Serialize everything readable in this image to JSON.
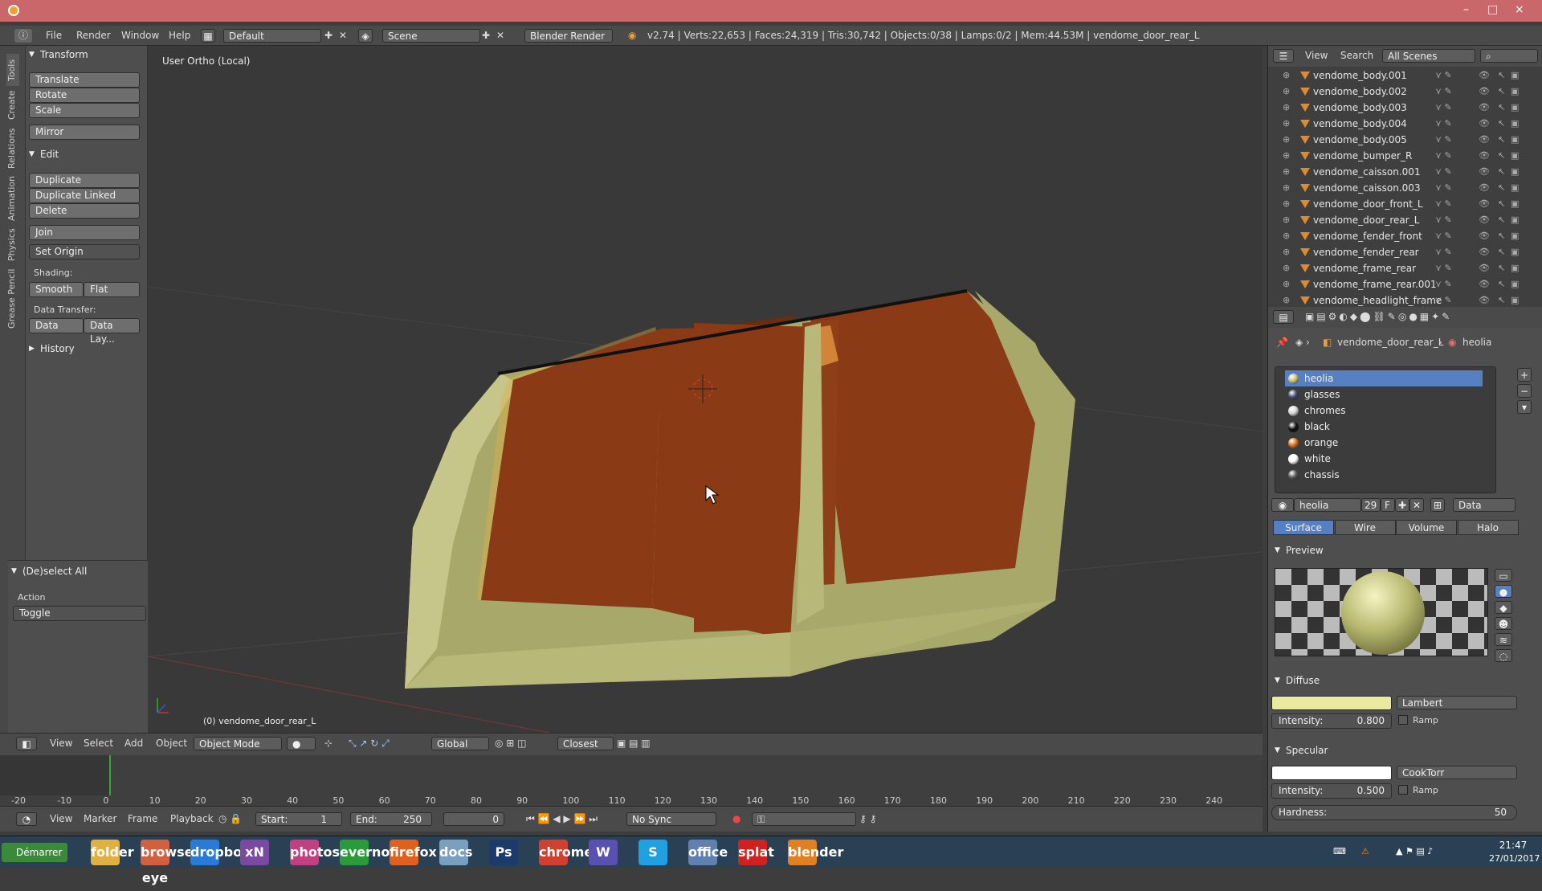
{
  "title_bar": {
    "controls": [
      "–",
      "□",
      "×"
    ]
  },
  "info_header": {
    "menus": [
      "File",
      "Render",
      "Window",
      "Help"
    ],
    "layout": "Default",
    "scene": "Scene",
    "render_engine": "Blender Render",
    "stats": "v2.74 | Verts:22,653 | Faces:24,319 | Tris:30,742 | Objects:0/38 | Lamps:0/2 | Mem:44.53M | vendome_door_rear_L"
  },
  "left_tabs": [
    "Tools",
    "Create",
    "Relations",
    "Animation",
    "Physics",
    "Grease Pencil"
  ],
  "tool_shelf": {
    "transform_header": "Transform",
    "transform_buttons": [
      "Translate",
      "Rotate",
      "Scale"
    ],
    "mirror": "Mirror",
    "edit_header": "Edit",
    "edit_buttons": [
      "Duplicate",
      "Duplicate Linked",
      "Delete"
    ],
    "join": "Join",
    "set_origin": "Set Origin",
    "shading_label": "Shading:",
    "smooth": "Smooth",
    "flat": "Flat",
    "data_transfer_label": "Data Transfer:",
    "data": "Data",
    "data_layers": "Data Lay...",
    "history_header": "History",
    "operator_header": "(De)select All",
    "action_label": "Action",
    "action_value": "Toggle"
  },
  "viewport": {
    "view_label": "User Ortho (Local)",
    "object_label": "(0) vendome_door_rear_L",
    "body_color": "#b8b878",
    "panel_color": "#8a3a14"
  },
  "viewport_header": {
    "menus": [
      "View",
      "Select",
      "Add",
      "Object"
    ],
    "mode": "Object Mode",
    "orientation": "Global",
    "snap": "Closest"
  },
  "timeline": {
    "ticks": [
      "-20",
      "-10",
      "0",
      "10",
      "20",
      "30",
      "40",
      "50",
      "60",
      "70",
      "80",
      "90",
      "100",
      "110",
      "120",
      "130",
      "140",
      "150",
      "160",
      "170",
      "180",
      "190",
      "200",
      "210",
      "220",
      "230",
      "240"
    ],
    "menus": [
      "View",
      "Marker",
      "Frame",
      "Playback"
    ],
    "start": "Start:",
    "start_val": "1",
    "end": "End:",
    "end_val": "250",
    "current": "0",
    "sync": "No Sync"
  },
  "outliner": {
    "menus": [
      "View",
      "Search"
    ],
    "filter": "All Scenes",
    "items": [
      {
        "name": "vendome_body.001"
      },
      {
        "name": "vendome_body.002"
      },
      {
        "name": "vendome_body.003"
      },
      {
        "name": "vendome_body.004"
      },
      {
        "name": "vendome_body.005"
      },
      {
        "name": "vendome_bumper_R"
      },
      {
        "name": "vendome_caisson.001"
      },
      {
        "name": "vendome_caisson.003"
      },
      {
        "name": "vendome_door_front_L"
      },
      {
        "name": "vendome_door_rear_L"
      },
      {
        "name": "vendome_fender_front"
      },
      {
        "name": "vendome_fender_rear"
      },
      {
        "name": "vendome_frame_rear"
      },
      {
        "name": "vendome_frame_rear.001"
      },
      {
        "name": "vendome_headlight_frame"
      }
    ]
  },
  "properties": {
    "breadcrumb_object": "vendome_door_rear_L",
    "breadcrumb_material": "heolia",
    "materials": [
      {
        "name": "heolia",
        "color": "#c8c070"
      },
      {
        "name": "glasses",
        "color": "#404a70"
      },
      {
        "name": "chromes",
        "color": "#d8d8d8"
      },
      {
        "name": "black",
        "color": "#111111"
      },
      {
        "name": "orange",
        "color": "#e07020"
      },
      {
        "name": "white",
        "color": "#ffffff"
      },
      {
        "name": "chassis",
        "color": "#555555"
      }
    ],
    "material_name": "heolia",
    "users": "29",
    "fake": "F",
    "link": "Data",
    "tabs": [
      "Surface",
      "Wire",
      "Volume",
      "Halo"
    ],
    "preview_header": "Preview",
    "diffuse_header": "Diffuse",
    "diffuse_color": "#e8eaa0",
    "diffuse_shader": "Lambert",
    "diffuse_intensity_label": "Intensity:",
    "diffuse_intensity": "0.800",
    "ramp": "Ramp",
    "specular_header": "Specular",
    "specular_color": "#ffffff",
    "specular_shader": "CookTorr",
    "specular_intensity_label": "Intensity:",
    "specular_intensity": "0.500",
    "hardness_label": "Hardness:",
    "hardness": "50"
  },
  "taskbar": {
    "start": "Démarrer",
    "apps": [
      "folder",
      "browser-eye",
      "dropbox",
      "xN",
      "photos",
      "evernote",
      "firefox",
      "docs",
      "Ps",
      "chrome",
      "W",
      "S",
      "office",
      "splat",
      "blender"
    ],
    "time": "21:47",
    "date": "27/01/2017"
  }
}
